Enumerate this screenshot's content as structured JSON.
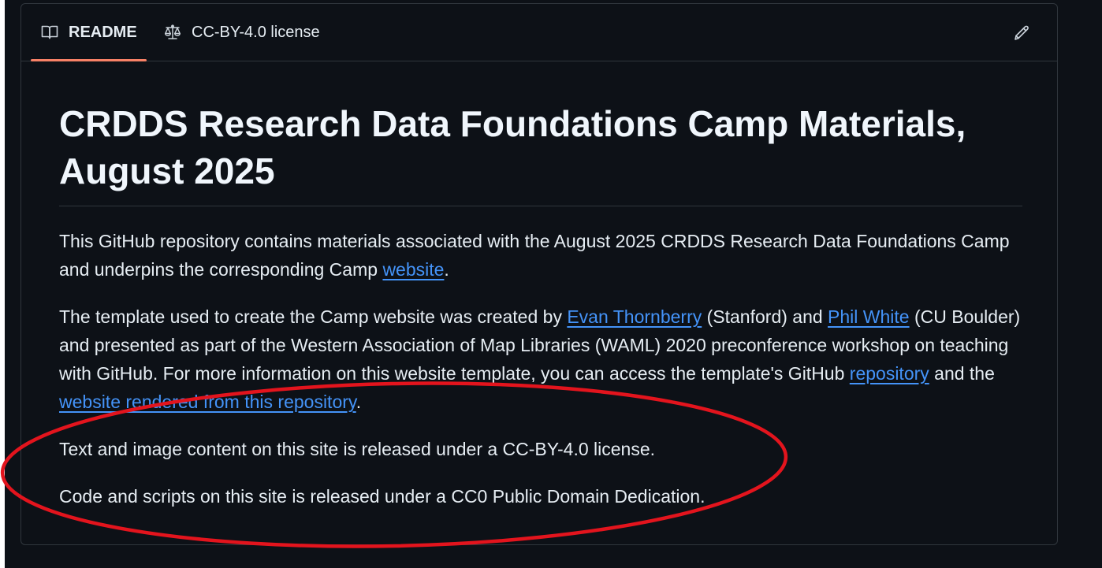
{
  "tabs": [
    {
      "label": "README",
      "icon": "book-icon"
    },
    {
      "label": "CC-BY-4.0 license",
      "icon": "scale-icon"
    }
  ],
  "edit_icon": "pencil-icon",
  "readme": {
    "title": "CRDDS Research Data Foundations Camp Materials, August 2025",
    "p1": {
      "text": "This GitHub repository contains materials associated with the August 2025 CRDDS Research Data Foundations Camp and underpins the corresponding Camp ",
      "link": "website",
      "end": "."
    },
    "p2": {
      "t1": "The template used to create the Camp website was created by ",
      "link1": "Evan Thornberry",
      "t2": " (Stanford) and ",
      "link2": "Phil White",
      "t3": " (CU Boulder) and presented as part of the Western Association of Map Libraries (WAML) 2020 preconference workshop on teaching with GitHub. For more information on this website template, you can access the template's GitHub ",
      "link3": "repository",
      "t4": " and the ",
      "link4": "website rendered from this repository",
      "t5": "."
    },
    "p3": "Text and image content on this site is released under a CC-BY-4.0 license.",
    "p4": "Code and scripts on this site is released under a CC0 Public Domain Dedication."
  },
  "colors": {
    "background": "#0d1117",
    "border": "#30363d",
    "text": "#e6edf3",
    "link": "#4493f8",
    "active_tab_underline": "#f78166",
    "annotation": "#e3141d"
  }
}
